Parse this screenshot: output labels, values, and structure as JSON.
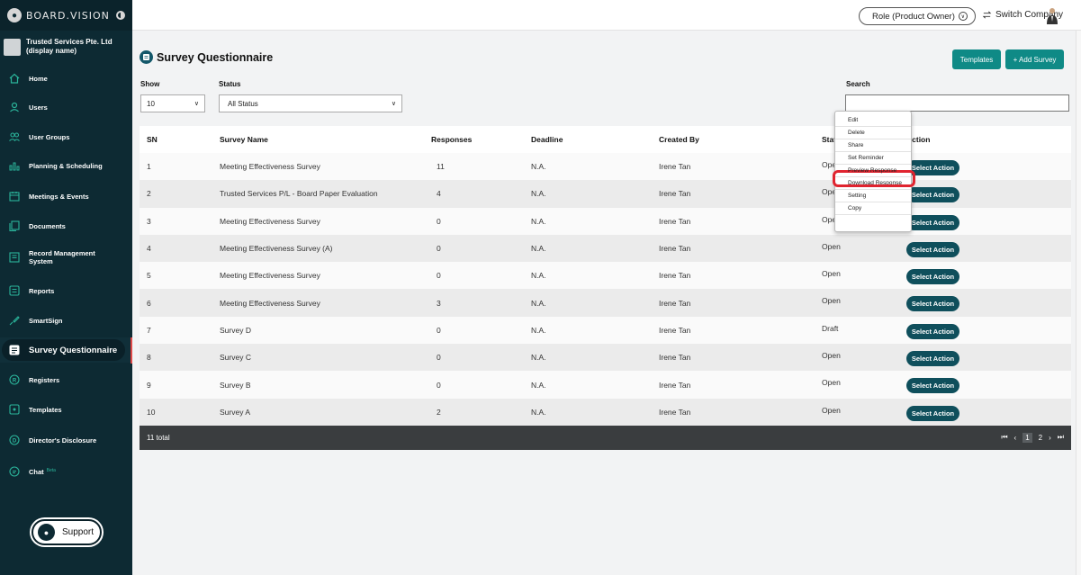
{
  "brand": {
    "name": "BOARD.VISION"
  },
  "organization": {
    "line1": "Trusted Services Pte. Ltd",
    "line2": "(display name)"
  },
  "sidebar": {
    "items": [
      {
        "label": "Home",
        "icon": "home-icon"
      },
      {
        "label": "Users",
        "icon": "user-icon"
      },
      {
        "label": "User Groups",
        "icon": "user-group-icon"
      },
      {
        "label": "Planning & Scheduling",
        "icon": "planning-icon"
      },
      {
        "label": "Meetings & Events",
        "icon": "calendar-icon"
      },
      {
        "label": "Documents",
        "icon": "documents-icon"
      },
      {
        "label": "Record Management",
        "label2": "System",
        "icon": "records-icon"
      },
      {
        "label": "Reports",
        "icon": "reports-icon"
      },
      {
        "label": "SmartSign",
        "icon": "signature-icon"
      },
      {
        "label": "Survey Questionnaire",
        "icon": "survey-icon",
        "active": true
      },
      {
        "label": "Registers",
        "icon": "registers-icon"
      },
      {
        "label": "Templates",
        "icon": "templates-icon"
      },
      {
        "label": "Director's Disclosure",
        "icon": "disclosure-icon"
      },
      {
        "label": "Chat",
        "badge": "Beta",
        "icon": "chat-icon"
      }
    ],
    "support_label": "Support"
  },
  "topbar": {
    "role_label": "Role (Product Owner)",
    "switch_company_label": "Switch Company"
  },
  "page": {
    "title": "Survey Questionnaire",
    "templates_button": "Templates",
    "add_button": "+ Add Survey",
    "show_label": "Show",
    "show_value": "10",
    "status_label": "Status",
    "status_value": "All Status",
    "search_label": "Search",
    "search_value": ""
  },
  "table": {
    "columns": [
      "SN",
      "Survey Name",
      "Responses",
      "Deadline",
      "Created By",
      "Status",
      "Action"
    ],
    "header_status_visible": "Stat",
    "rows": [
      {
        "sn": "1",
        "name": "Meeting Effectiveness Survey",
        "responses": "11",
        "deadline": "N.A.",
        "created_by": "Irene Tan",
        "status": "Ope",
        "action": "Select Action"
      },
      {
        "sn": "2",
        "name": "Trusted Services P/L - Board Paper Evaluation",
        "responses": "4",
        "deadline": "N.A.",
        "created_by": "Irene Tan",
        "status": "Ope",
        "action": "Select Action"
      },
      {
        "sn": "3",
        "name": "Meeting Effectiveness Survey",
        "responses": "0",
        "deadline": "N.A.",
        "created_by": "Irene Tan",
        "status": "Ope",
        "action": "Select Action"
      },
      {
        "sn": "4",
        "name": "Meeting Effectiveness Survey (A)",
        "responses": "0",
        "deadline": "N.A.",
        "created_by": "Irene Tan",
        "status": "Open",
        "action": "Select Action"
      },
      {
        "sn": "5",
        "name": "Meeting Effectiveness Survey",
        "responses": "0",
        "deadline": "N.A.",
        "created_by": "Irene Tan",
        "status": "Open",
        "action": "Select Action"
      },
      {
        "sn": "6",
        "name": "Meeting Effectiveness Survey",
        "responses": "3",
        "deadline": "N.A.",
        "created_by": "Irene Tan",
        "status": "Open",
        "action": "Select Action"
      },
      {
        "sn": "7",
        "name": "Survey D",
        "responses": "0",
        "deadline": "N.A.",
        "created_by": "Irene Tan",
        "status": "Draft",
        "action": "Select Action"
      },
      {
        "sn": "8",
        "name": "Survey C",
        "responses": "0",
        "deadline": "N.A.",
        "created_by": "Irene Tan",
        "status": "Open",
        "action": "Select Action"
      },
      {
        "sn": "9",
        "name": "Survey B",
        "responses": "0",
        "deadline": "N.A.",
        "created_by": "Irene Tan",
        "status": "Open",
        "action": "Select Action"
      },
      {
        "sn": "10",
        "name": "Survey A",
        "responses": "2",
        "deadline": "N.A.",
        "created_by": "Irene Tan",
        "status": "Open",
        "action": "Select Action"
      }
    ],
    "total_label": "11 total",
    "pages": [
      "1",
      "2"
    ],
    "current_page": "1"
  },
  "action_menu": {
    "items": [
      "Edit",
      "Delete",
      "Share",
      "Set Reminder",
      "Preview Response",
      "Download Response",
      "Setting",
      "Copy"
    ],
    "highlighted": "Preview Response"
  },
  "colors": {
    "sidebar_bg": "#0d2a33",
    "accent_teal": "#0f8a86",
    "action_button": "#0f4f5c",
    "highlight_red": "#e0242f"
  }
}
